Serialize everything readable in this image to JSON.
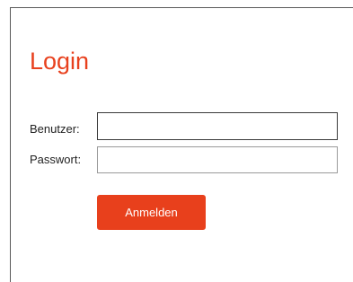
{
  "login": {
    "title": "Login",
    "username_label": "Benutzer:",
    "username_value": "",
    "password_label": "Passwort:",
    "password_value": "",
    "submit_label": "Anmelden"
  },
  "colors": {
    "accent": "#e8411e",
    "button_bg": "#e8401c",
    "button_text": "#ffffff"
  }
}
